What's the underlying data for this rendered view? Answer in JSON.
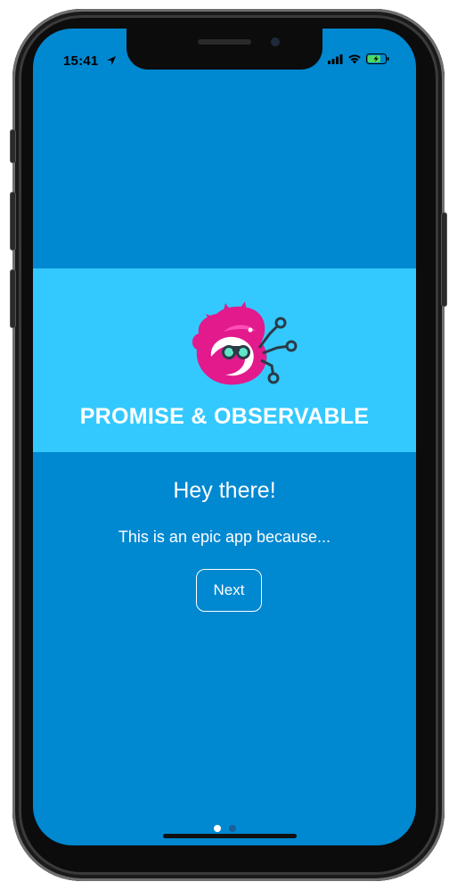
{
  "status_bar": {
    "time": "15:41",
    "location_icon": "location-arrow-icon",
    "signal_icon": "cellular-signal-icon",
    "wifi_icon": "wifi-icon",
    "battery_icon": "battery-charging-icon"
  },
  "banner": {
    "logo_icon": "redux-observable-logo",
    "title": "PROMISE & OBSERVABLE"
  },
  "content": {
    "headline": "Hey there!",
    "subtitle": "This is an epic app because...",
    "next_label": "Next"
  },
  "pager": {
    "total": 2,
    "active": 1
  },
  "colors": {
    "background": "#0088d1",
    "banner": "#33c9ff",
    "text": "#ffffff",
    "dot_active": "#ffffff",
    "dot_inactive": "#1a5f99",
    "battery_fill": "#4cd964"
  }
}
